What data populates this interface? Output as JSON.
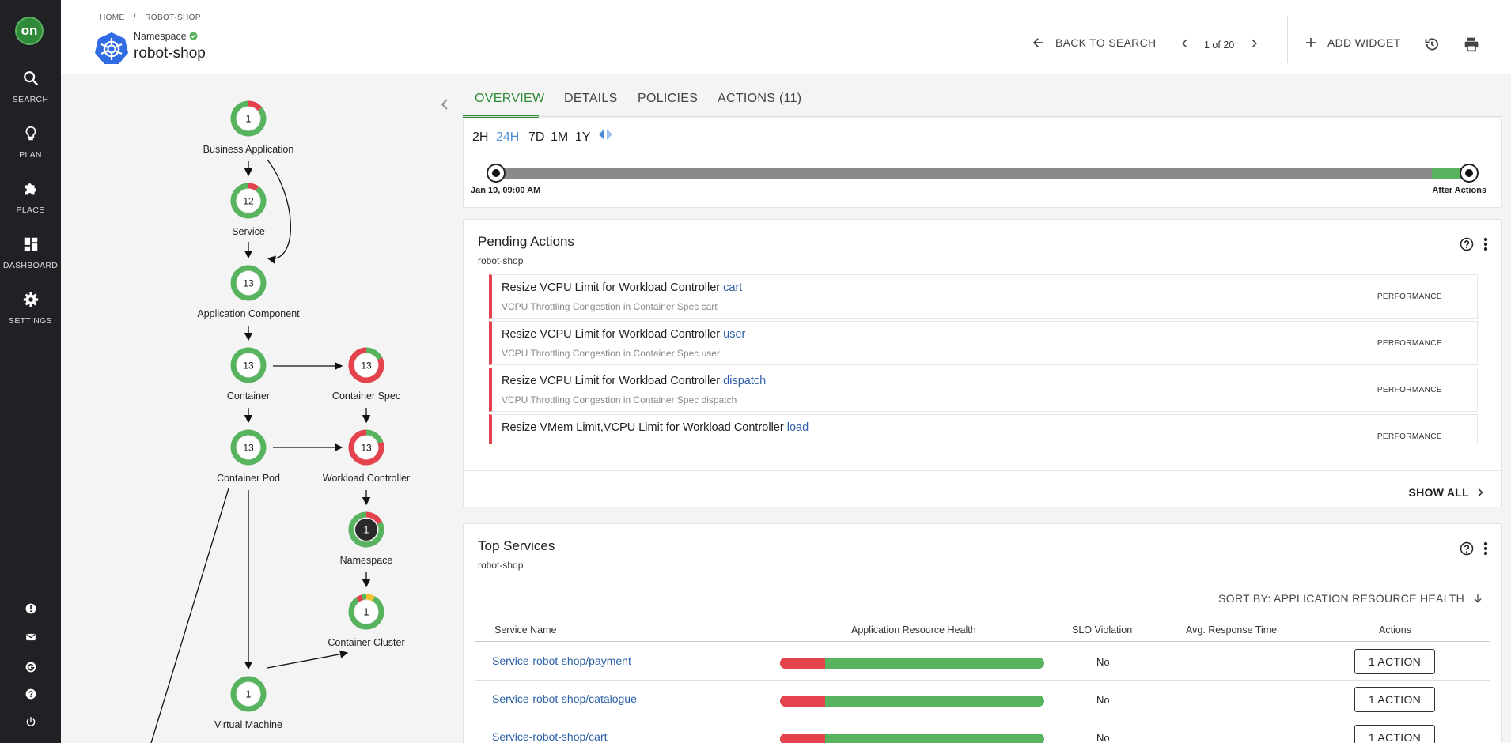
{
  "nav": {
    "logo": "on",
    "items": [
      {
        "label": "SEARCH",
        "icon": "search-icon"
      },
      {
        "label": "PLAN",
        "icon": "lightbulb-icon"
      },
      {
        "label": "PLACE",
        "icon": "puzzle-icon"
      },
      {
        "label": "DASHBOARD",
        "icon": "dashboard-icon"
      },
      {
        "label": "SETTINGS",
        "icon": "gear-icon"
      }
    ],
    "bottom_icons": [
      "alert-icon",
      "mail-icon",
      "google-icon",
      "help-icon",
      "power-icon"
    ]
  },
  "header": {
    "breadcrumb": [
      "HOME",
      "/",
      "ROBOT-SHOP"
    ],
    "entity_type": "Namespace",
    "entity_name": "robot-shop",
    "back_label": "BACK TO SEARCH",
    "pager": "1 of 20",
    "add_widget_label": "ADD WIDGET"
  },
  "tree": {
    "nodes": [
      {
        "label": "Business Application",
        "count": "1"
      },
      {
        "label": "Service",
        "count": "12"
      },
      {
        "label": "Application Component",
        "count": "13"
      },
      {
        "label": "Container",
        "count": "13"
      },
      {
        "label": "Container Spec",
        "count": "13"
      },
      {
        "label": "Container Pod",
        "count": "13"
      },
      {
        "label": "Workload Controller",
        "count": "13"
      },
      {
        "label": "Namespace",
        "count": "1"
      },
      {
        "label": "Container Cluster",
        "count": "1"
      },
      {
        "label": "Virtual Machine",
        "count": "1"
      }
    ]
  },
  "tabs": [
    "OVERVIEW",
    "DETAILS",
    "POLICIES",
    "ACTIONS (11)"
  ],
  "timeline": {
    "ranges": [
      "2H",
      "24H",
      "7D",
      "1M",
      "1Y"
    ],
    "selected": "24H",
    "start_label": "Jan 19, 09:00 AM",
    "end_label": "After Actions"
  },
  "pending": {
    "title": "Pending Actions",
    "subtitle": "robot-shop",
    "actions": [
      {
        "title": "Resize VCPU Limit for Workload Controller ",
        "target": "cart",
        "detail": "VCPU Throttling Congestion in Container Spec cart",
        "badge": "PERFORMANCE"
      },
      {
        "title": "Resize VCPU Limit for Workload Controller ",
        "target": "user",
        "detail": "VCPU Throttling Congestion in Container Spec user",
        "badge": "PERFORMANCE"
      },
      {
        "title": "Resize VCPU Limit for Workload Controller ",
        "target": "dispatch",
        "detail": "VCPU Throttling Congestion in Container Spec dispatch",
        "badge": "PERFORMANCE"
      },
      {
        "title": "Resize VMem Limit,VCPU Limit for Workload Controller ",
        "target": "load",
        "detail": "",
        "badge": "PERFORMANCE"
      }
    ],
    "show_all": "SHOW ALL"
  },
  "top_services": {
    "title": "Top Services",
    "subtitle": "robot-shop",
    "sort_by": "SORT BY: APPLICATION RESOURCE HEALTH",
    "columns": [
      "Service Name",
      "Application Resource Health",
      "SLO Violation",
      "Avg. Response Time",
      "Actions"
    ],
    "rows": [
      {
        "name": "Service-robot-shop/payment",
        "health_red_pct": 17,
        "slo": "No",
        "avg": "",
        "action": "1 ACTION"
      },
      {
        "name": "Service-robot-shop/catalogue",
        "health_red_pct": 17,
        "slo": "No",
        "avg": "",
        "action": "1 ACTION"
      },
      {
        "name": "Service-robot-shop/cart",
        "health_red_pct": 17,
        "slo": "No",
        "avg": "",
        "action": "1 ACTION"
      }
    ]
  },
  "colors": {
    "accent": "#2e8a36",
    "critical": "#e4424d",
    "healthy": "#58b35f",
    "link": "#2b5fa8",
    "nav_bg": "#202124"
  }
}
